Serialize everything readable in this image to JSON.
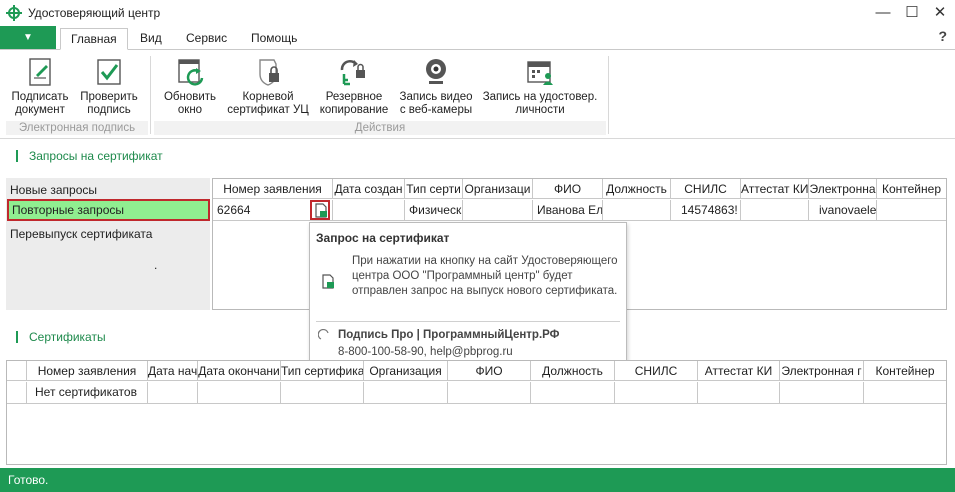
{
  "window": {
    "title": "Удостоверяющий центр",
    "minimize": "—",
    "maximize": "☐",
    "close": "✕"
  },
  "ribbon": {
    "file_menu": "▼",
    "tabs": [
      "Главная",
      "Вид",
      "Сервис",
      "Помощь"
    ],
    "help": "?",
    "buttons": {
      "sign_doc": "Подписать документ",
      "verify_sig": "Проверить подпись",
      "refresh": "Обновить окно",
      "root_cert": "Корневой сертификат УЦ",
      "backup": "Резервное копирование",
      "webcam": "Запись видео с веб-камеры",
      "appointment": "Запись на удостовер. личности"
    },
    "groups": {
      "esign": "Электронная подпись",
      "actions": "Действия"
    }
  },
  "requests": {
    "section_title": "Запросы на сертификат",
    "left_items": [
      "Новые запросы",
      "Повторные запросы",
      "Перевыпуск сертификата"
    ],
    "dot": ".",
    "columns": [
      "Номер заявления",
      "Дата создан",
      "Тип серти",
      "Организаци",
      "ФИО",
      "Должность",
      "СНИЛС",
      "Аттестат КИ",
      "Электронна",
      "Контейнер"
    ],
    "rows": [
      {
        "number": "62664",
        "date": "",
        "type": "Физическ",
        "org": "",
        "fio": "Иванова Ел",
        "position": "",
        "snils": "14574863!",
        "attestat": "",
        "email": "ivanovaele",
        "container": ""
      }
    ]
  },
  "tooltip": {
    "title": "Запрос на сертификат",
    "body": "При нажатии на кнопку на сайт Удостоверяющего центра ООО \"Программный центр\" будет отправлен запрос на выпуск нового сертификата.",
    "footer": "Подпись Про | ПрограммныйЦентр.РФ",
    "contact": "8-800-100-58-90, help@pbprog.ru"
  },
  "certificates": {
    "section_title": "Сертификаты",
    "columns": [
      "Номер заявления",
      "Дата нач",
      "Дата окончани",
      "Тип сертифика",
      "Организация",
      "ФИО",
      "Должность",
      "СНИЛС",
      "Аттестат КИ",
      "Электронная г",
      "Контейнер"
    ],
    "empty_text": "Нет сертификатов"
  },
  "status": {
    "text": "Готово."
  },
  "colors": {
    "accent": "#1e9a55",
    "selection": "#90ee90",
    "highlight_border": "#c0282d"
  }
}
